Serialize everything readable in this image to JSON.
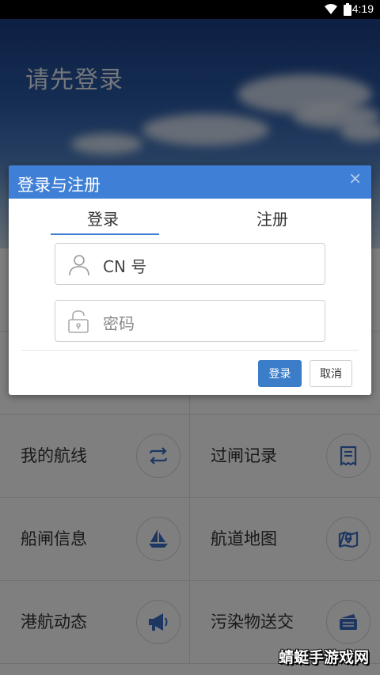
{
  "status_bar": {
    "time": "4:19"
  },
  "hero": {
    "title": "请先登录"
  },
  "grid": [
    {
      "label": "我的航线",
      "icon": "swap-arrows-icon"
    },
    {
      "label": "过闸记录",
      "icon": "receipt-icon"
    },
    {
      "label": "船闸信息",
      "icon": "sailboat-icon"
    },
    {
      "label": "航道地图",
      "icon": "map-pin-icon"
    },
    {
      "label": "港航动态",
      "icon": "megaphone-icon"
    },
    {
      "label": "污染物送交",
      "icon": "wallet-cards-icon"
    }
  ],
  "modal": {
    "title": "登录与注册",
    "close": "×",
    "tabs": {
      "login": "登录",
      "register": "注册"
    },
    "cn_field": {
      "value": "CN 号"
    },
    "password_field": {
      "placeholder": "密码"
    },
    "buttons": {
      "login": "登录",
      "cancel": "取消"
    }
  },
  "watermark": "蜻蜓手游戏网",
  "colors": {
    "accent": "#3f80d6",
    "button": "#3c7dc9",
    "icon_blue": "#3b6fc4"
  }
}
